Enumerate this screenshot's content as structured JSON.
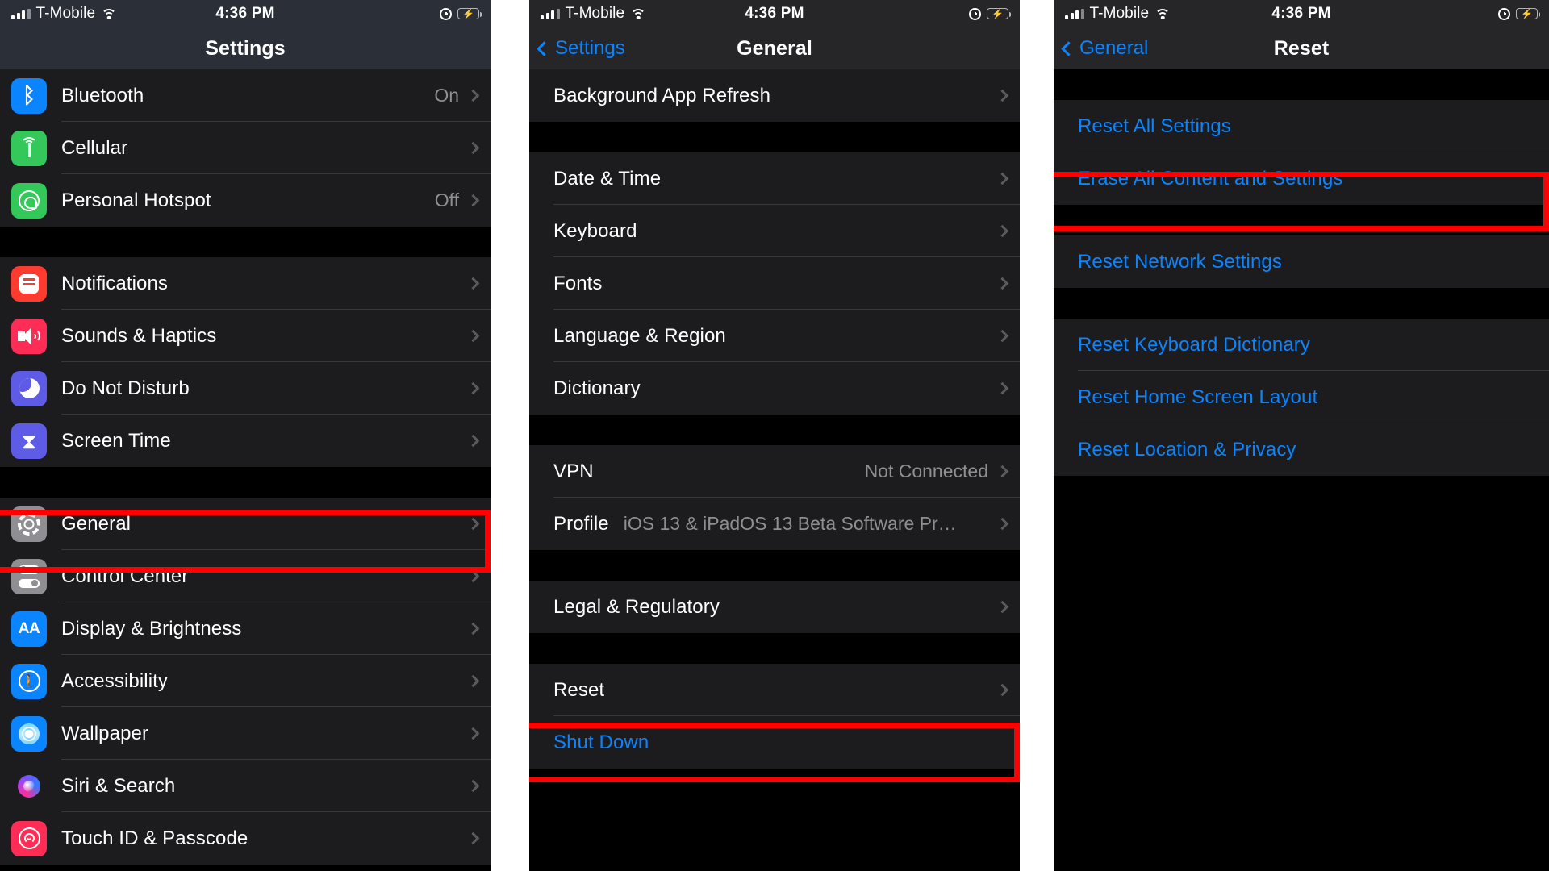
{
  "status_bar": {
    "carrier": "T-Mobile",
    "time": "4:36 PM",
    "icons": [
      "signal-bars-icon",
      "wifi-icon",
      "alarm-clock-icon",
      "battery-charging-icon"
    ]
  },
  "colors": {
    "highlight": "#ff0000",
    "accent_blue": "#0a84ff",
    "list_bg": "#1c1c1e",
    "page_bg": "#000000",
    "separator": "#38383a",
    "secondary_text": "#8e8e93"
  },
  "panels": [
    {
      "id": "settings",
      "nav": {
        "title": "Settings",
        "back": null
      },
      "groups": [
        {
          "rows": [
            {
              "label": "Bluetooth",
              "value": "On",
              "icon": "bluetooth-icon",
              "icon_bg": "#0a84ff",
              "chevron": true
            },
            {
              "label": "Cellular",
              "value": "",
              "icon": "cellular-icon",
              "icon_bg": "#34c759",
              "chevron": true
            },
            {
              "label": "Personal Hotspot",
              "value": "Off",
              "icon": "personal-hotspot-icon",
              "icon_bg": "#34c759",
              "chevron": true
            }
          ]
        },
        {
          "rows": [
            {
              "label": "Notifications",
              "value": "",
              "icon": "notifications-icon",
              "icon_bg": "#ff3b30",
              "chevron": true
            },
            {
              "label": "Sounds & Haptics",
              "value": "",
              "icon": "sounds-haptics-icon",
              "icon_bg": "#ff2d55",
              "chevron": true
            },
            {
              "label": "Do Not Disturb",
              "value": "",
              "icon": "do-not-disturb-icon",
              "icon_bg": "#5e5ce6",
              "chevron": true
            },
            {
              "label": "Screen Time",
              "value": "",
              "icon": "screen-time-icon",
              "icon_bg": "#5e5ce6",
              "chevron": true
            }
          ]
        },
        {
          "rows": [
            {
              "label": "General",
              "value": "",
              "icon": "general-gear-icon",
              "icon_bg": "#8e8e93",
              "chevron": true,
              "highlighted": true
            },
            {
              "label": "Control Center",
              "value": "",
              "icon": "control-center-icon",
              "icon_bg": "#8e8e93",
              "chevron": true
            },
            {
              "label": "Display & Brightness",
              "value": "",
              "icon": "display-brightness-icon",
              "icon_bg": "#0a84ff",
              "chevron": true
            },
            {
              "label": "Accessibility",
              "value": "",
              "icon": "accessibility-icon",
              "icon_bg": "#0a84ff",
              "chevron": true
            },
            {
              "label": "Wallpaper",
              "value": "",
              "icon": "wallpaper-icon",
              "icon_bg": "#0a84ff",
              "chevron": true
            },
            {
              "label": "Siri & Search",
              "value": "",
              "icon": "siri-search-icon",
              "icon_bg": "#1c1c1e",
              "chevron": true
            },
            {
              "label": "Touch ID & Passcode",
              "value": "",
              "icon": "touch-id-icon",
              "icon_bg": "#ff2d55",
              "chevron": true
            }
          ]
        }
      ]
    },
    {
      "id": "general",
      "nav": {
        "title": "General",
        "back": "Settings"
      },
      "groups": [
        {
          "rows": [
            {
              "label": "Background App Refresh",
              "value": "",
              "chevron": true
            }
          ]
        },
        {
          "rows": [
            {
              "label": "Date & Time",
              "value": "",
              "chevron": true
            },
            {
              "label": "Keyboard",
              "value": "",
              "chevron": true
            },
            {
              "label": "Fonts",
              "value": "",
              "chevron": true
            },
            {
              "label": "Language & Region",
              "value": "",
              "chevron": true
            },
            {
              "label": "Dictionary",
              "value": "",
              "chevron": true
            }
          ]
        },
        {
          "rows": [
            {
              "label": "VPN",
              "value": "Not Connected",
              "chevron": true
            },
            {
              "label": "Profile",
              "value": "iOS 13 & iPadOS 13 Beta Software Pr…",
              "value_inline": true,
              "chevron": true
            }
          ]
        },
        {
          "rows": [
            {
              "label": "Legal & Regulatory",
              "value": "",
              "chevron": true
            }
          ]
        },
        {
          "rows": [
            {
              "label": "Reset",
              "value": "",
              "chevron": true,
              "highlighted": true
            },
            {
              "label": "Shut Down",
              "value": "",
              "chevron": false,
              "blue": true
            }
          ]
        }
      ]
    },
    {
      "id": "reset",
      "nav": {
        "title": "Reset",
        "back": "General"
      },
      "groups": [
        {
          "rows": [
            {
              "label": "Reset All Settings",
              "blue": true,
              "chevron": false
            },
            {
              "label": "Erase All Content and Settings",
              "blue": true,
              "chevron": false,
              "highlighted": true
            }
          ]
        },
        {
          "rows": [
            {
              "label": "Reset Network Settings",
              "blue": true,
              "chevron": false
            }
          ]
        },
        {
          "rows": [
            {
              "label": "Reset Keyboard Dictionary",
              "blue": true,
              "chevron": false
            },
            {
              "label": "Reset Home Screen Layout",
              "blue": true,
              "chevron": false
            },
            {
              "label": "Reset Location & Privacy",
              "blue": true,
              "chevron": false
            }
          ]
        }
      ]
    }
  ]
}
